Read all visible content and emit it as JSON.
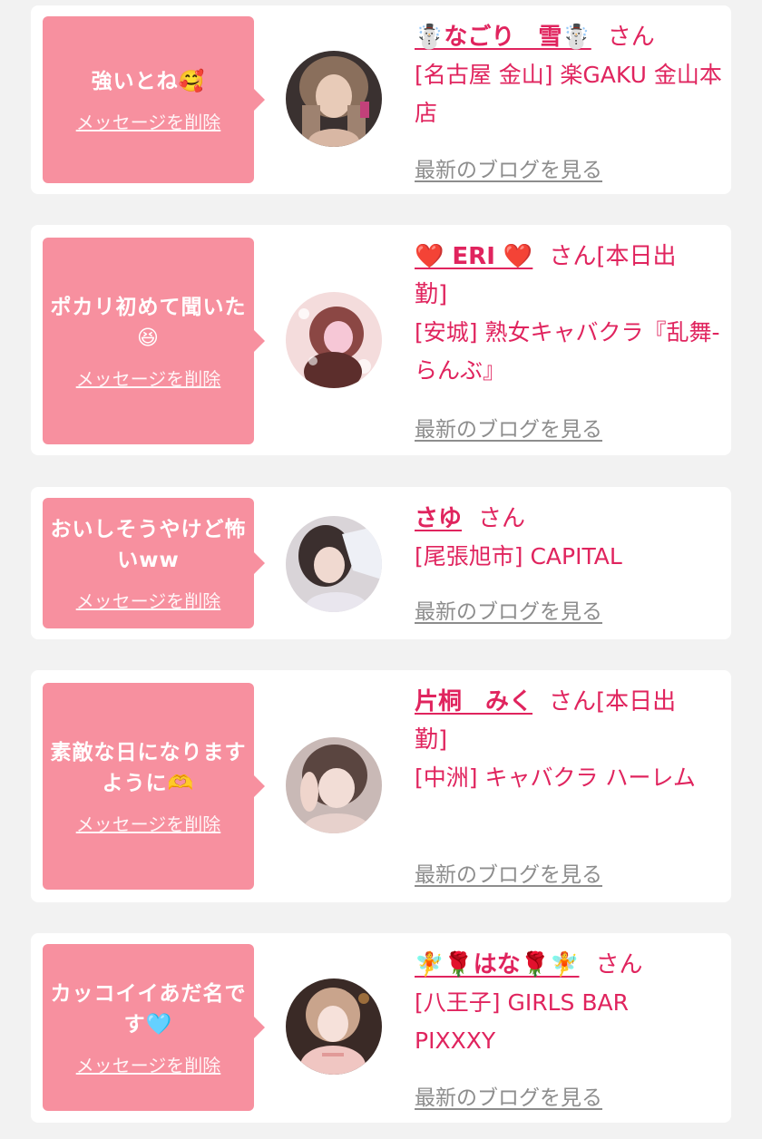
{
  "messages": [
    {
      "text": "強いとね🥰",
      "delete_label": "メッセージを削除",
      "cast_name": "☃️なごり　雪☃️",
      "honorific": "さん",
      "status": "",
      "shop": "[名古屋 金山] 楽GAKU 金山本店",
      "blog_label": "最新のブログを見る"
    },
    {
      "text": "ポカリ初めて聞いた😆",
      "delete_label": "メッセージを削除",
      "cast_name": "❤️ ERI ❤️",
      "honorific": "さん",
      "status": "[本日出勤]",
      "shop": "[安城] 熟女キャバクラ『乱舞-らんぶ』",
      "blog_label": "最新のブログを見る"
    },
    {
      "text": "おいしそうやけど怖いww",
      "delete_label": "メッセージを削除",
      "cast_name": "さゆ",
      "honorific": "さん",
      "status": "",
      "shop": "[尾張旭市] CAPITAL",
      "blog_label": "最新のブログを見る"
    },
    {
      "text": "素敵な日になりますように🫶",
      "delete_label": "メッセージを削除",
      "cast_name": "片桐　みく",
      "honorific": "さん",
      "status": "[本日出勤]",
      "shop": "[中洲] キャバクラ ハーレム",
      "blog_label": "最新のブログを見る"
    },
    {
      "text": "カッコイイあだ名です🩵",
      "delete_label": "メッセージを削除",
      "cast_name": "🧚🌹はな🌹🧚",
      "honorific": "さん",
      "status": "",
      "shop": "[八王子] GIRLS BAR PIXXXY",
      "blog_label": "最新のブログを見る"
    }
  ]
}
